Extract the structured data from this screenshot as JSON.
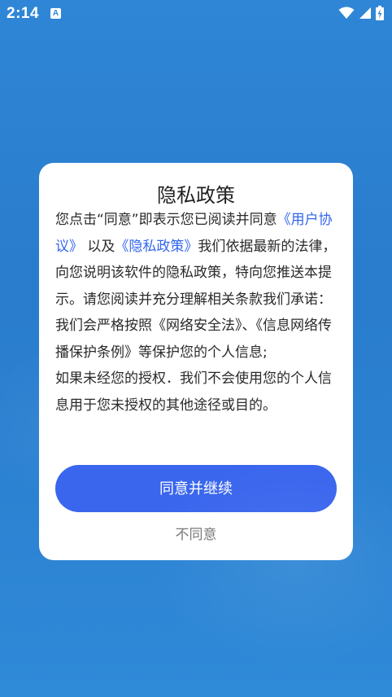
{
  "status_bar": {
    "time": "2:14",
    "app_icon_letter": "A",
    "icons": [
      "wifi-icon",
      "signal-icon",
      "battery-charging-icon"
    ]
  },
  "dialog": {
    "title": "隐私政策",
    "body": {
      "p1_a": "您点击“同意”即表示您已阅读并同意",
      "p1_link1": "《用户协议》",
      "p1_b": "以及",
      "p1_link2": "《隐私政策》",
      "p1_c": "我们依据最新的法律，向您说明该软件的隐私政策，特向您推送本提示。请您阅读并充分理解相关条款我们承诺：",
      "p2": "我们会严格按照《网络安全法》、《信息网络传播保护条例》等保护您的个人信息;",
      "p3": "如果未经您的授权．我们不会使用您的个人信息用于您未授权的其他途径或目的。"
    },
    "agree_label": "同意并继续",
    "disagree_label": "不同意"
  },
  "colors": {
    "background": "#2f86d6",
    "link": "#3366ee",
    "primary_button": "#3a66ee",
    "dialog_bg": "#ffffff"
  }
}
